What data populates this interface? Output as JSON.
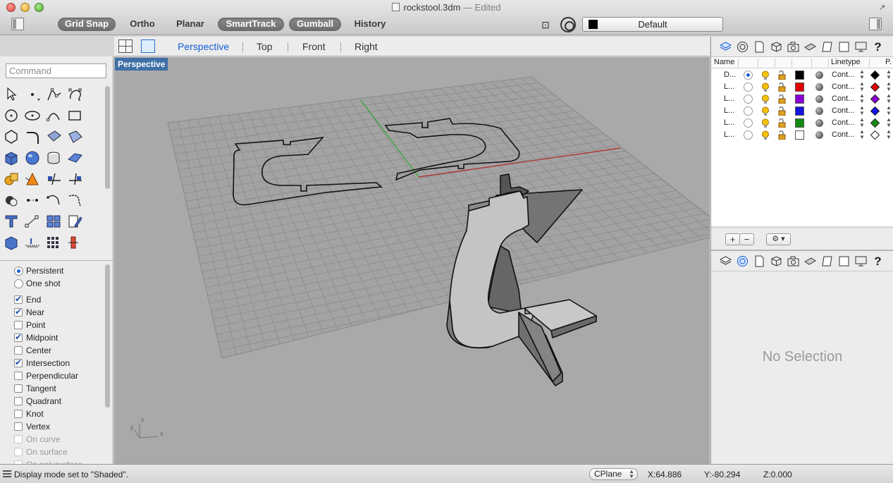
{
  "window": {
    "title": "rockstool.3dm",
    "edited": "— Edited"
  },
  "toolbar": {
    "modes": [
      {
        "label": "Grid Snap",
        "on": true
      },
      {
        "label": "Ortho",
        "on": false
      },
      {
        "label": "Planar",
        "on": false
      },
      {
        "label": "SmartTrack",
        "on": true
      },
      {
        "label": "Gumball",
        "on": true
      },
      {
        "label": "History",
        "on": false
      }
    ],
    "layer_select": "Default"
  },
  "view_tabs": [
    "Perspective",
    "Top",
    "Front",
    "Right"
  ],
  "active_view": "Perspective",
  "command": {
    "placeholder": "Command"
  },
  "snaps": {
    "persistent": "Persistent",
    "one_shot": "One shot",
    "items": [
      {
        "label": "End",
        "checked": true
      },
      {
        "label": "Near",
        "checked": true
      },
      {
        "label": "Point",
        "checked": false
      },
      {
        "label": "Midpoint",
        "checked": true
      },
      {
        "label": "Center",
        "checked": false
      },
      {
        "label": "Intersection",
        "checked": true
      },
      {
        "label": "Perpendicular",
        "checked": false
      },
      {
        "label": "Tangent",
        "checked": false
      },
      {
        "label": "Quadrant",
        "checked": false
      },
      {
        "label": "Knot",
        "checked": false
      },
      {
        "label": "Vertex",
        "checked": false
      },
      {
        "label": "On curve",
        "checked": false,
        "disabled": true
      },
      {
        "label": "On surface",
        "checked": false,
        "disabled": true
      },
      {
        "label": "On polysurface",
        "checked": false,
        "disabled": true
      }
    ]
  },
  "viewport": {
    "label": "Perspective",
    "axis_z": "z",
    "axis_y": "y",
    "axis_x": "x"
  },
  "layers": {
    "headers": {
      "name": "Name",
      "linetype": "Linetype",
      "print": "P."
    },
    "rows": [
      {
        "name": "D...",
        "current": true,
        "color": "#000000",
        "linetype": "Cont...",
        "print_color": "#000000"
      },
      {
        "name": "L...",
        "current": false,
        "color": "#e00000",
        "linetype": "Cont...",
        "print_color": "#e00000"
      },
      {
        "name": "L...",
        "current": false,
        "color": "#8a00d4",
        "linetype": "Cont...",
        "print_color": "#8a00d4"
      },
      {
        "name": "L...",
        "current": false,
        "color": "#1414e0",
        "linetype": "Cont...",
        "print_color": "#1414e0"
      },
      {
        "name": "L...",
        "current": false,
        "color": "#138a13",
        "linetype": "Cont...",
        "print_color": "#138a13"
      },
      {
        "name": "L...",
        "current": false,
        "color": "#ffffff",
        "linetype": "Cont...",
        "print_color": "#ffffff"
      }
    ],
    "add": "+",
    "remove": "−",
    "gear": "⚙ ▾"
  },
  "properties": {
    "empty": "No Selection"
  },
  "status": {
    "message": "Display mode set to \"Shaded\".",
    "cplane": "CPlane",
    "x": "X:64.886",
    "y": "Y:-80.294",
    "z": "Z:0.000"
  },
  "colors": {
    "viewport_bg": "#a9a9aa",
    "grid_line": "#8f8f90",
    "x_axis": "#b0392f",
    "y_axis": "#3aa63a",
    "accent": "#1560d4",
    "viewport_label": "#3f6fa6"
  }
}
